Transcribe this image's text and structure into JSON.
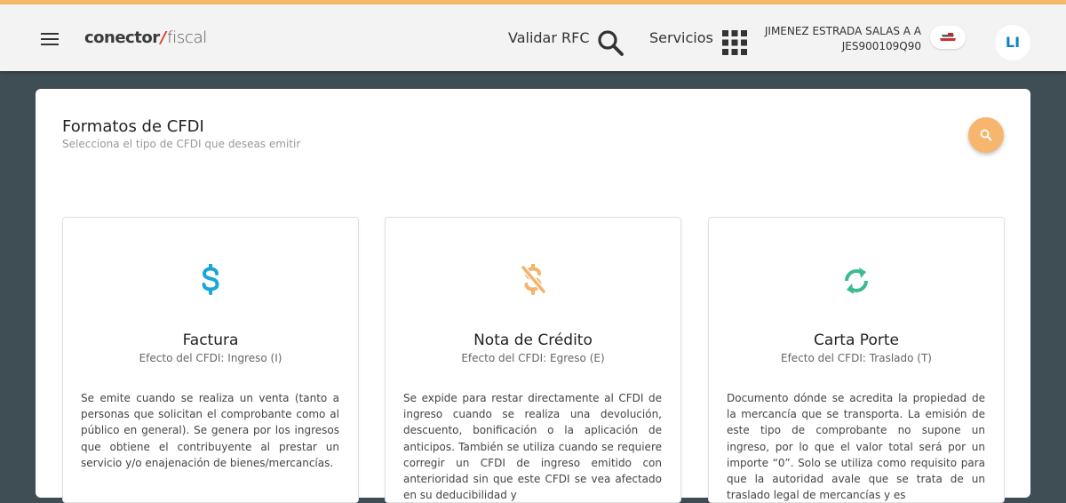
{
  "header": {
    "logo": {
      "part1": "conector",
      "part2": "fiscal"
    },
    "nav": {
      "validar_rfc": "Validar RFC",
      "servicios": "Servicios"
    },
    "user": {
      "name": "JIMENEZ ESTRADA SALAS A A",
      "rfc": "JES900109Q90",
      "initials": "LI"
    },
    "icons": {
      "menu": "menu-icon",
      "search": "search-icon",
      "apps": "apps-grid-icon",
      "flag": "mexico-flag-icon"
    }
  },
  "main": {
    "title": "Formatos de CFDI",
    "subtitle": "Selecciona el tipo de CFDI que deseas emitir",
    "fab_icon": "search-icon",
    "cards": [
      {
        "title": "Factura",
        "subtitle": "Efecto del CFDI: Ingreso (I)",
        "description": "Se emite cuando se realiza un venta (tanto a personas que solicitan el comprobante como al público en general). Se genera por los ingresos que obtiene el contribuyente al prestar un servicio y/o enajenación de bienes/mercancías.",
        "icon": "dollar-icon",
        "color": "#1aa7d6"
      },
      {
        "title": "Nota de Crédito",
        "subtitle": "Efecto del CFDI: Egreso (E)",
        "description": "Se expide para restar directamente al CFDI de ingreso cuando se realiza una devolución, descuento, bonificación o la aplicación de anticipos. También se utiliza cuando se requiere corregir un CFDI de ingreso emitido con anterioridad sin que este CFDI se vea afectado en su deducibilidad y",
        "icon": "no-dollar-icon",
        "color": "#f5b26b"
      },
      {
        "title": "Carta Porte",
        "subtitle": "Efecto del CFDI: Traslado (T)",
        "description": "Documento dónde se acredita la propiedad de la mercancía que se transporta. La emisión de este tipo de comprobante no supone un ingreso, por lo que el valor total será por un importe “0”. Solo se utiliza como requisito para que la autoridad avale que se trata de un traslado legal de mercancías y es",
        "icon": "refresh-icon",
        "color": "#3dbb8f"
      }
    ]
  },
  "colors": {
    "accent": "#f7b86a",
    "background": "#3f4d55",
    "primary_blue": "#0a84c7"
  }
}
